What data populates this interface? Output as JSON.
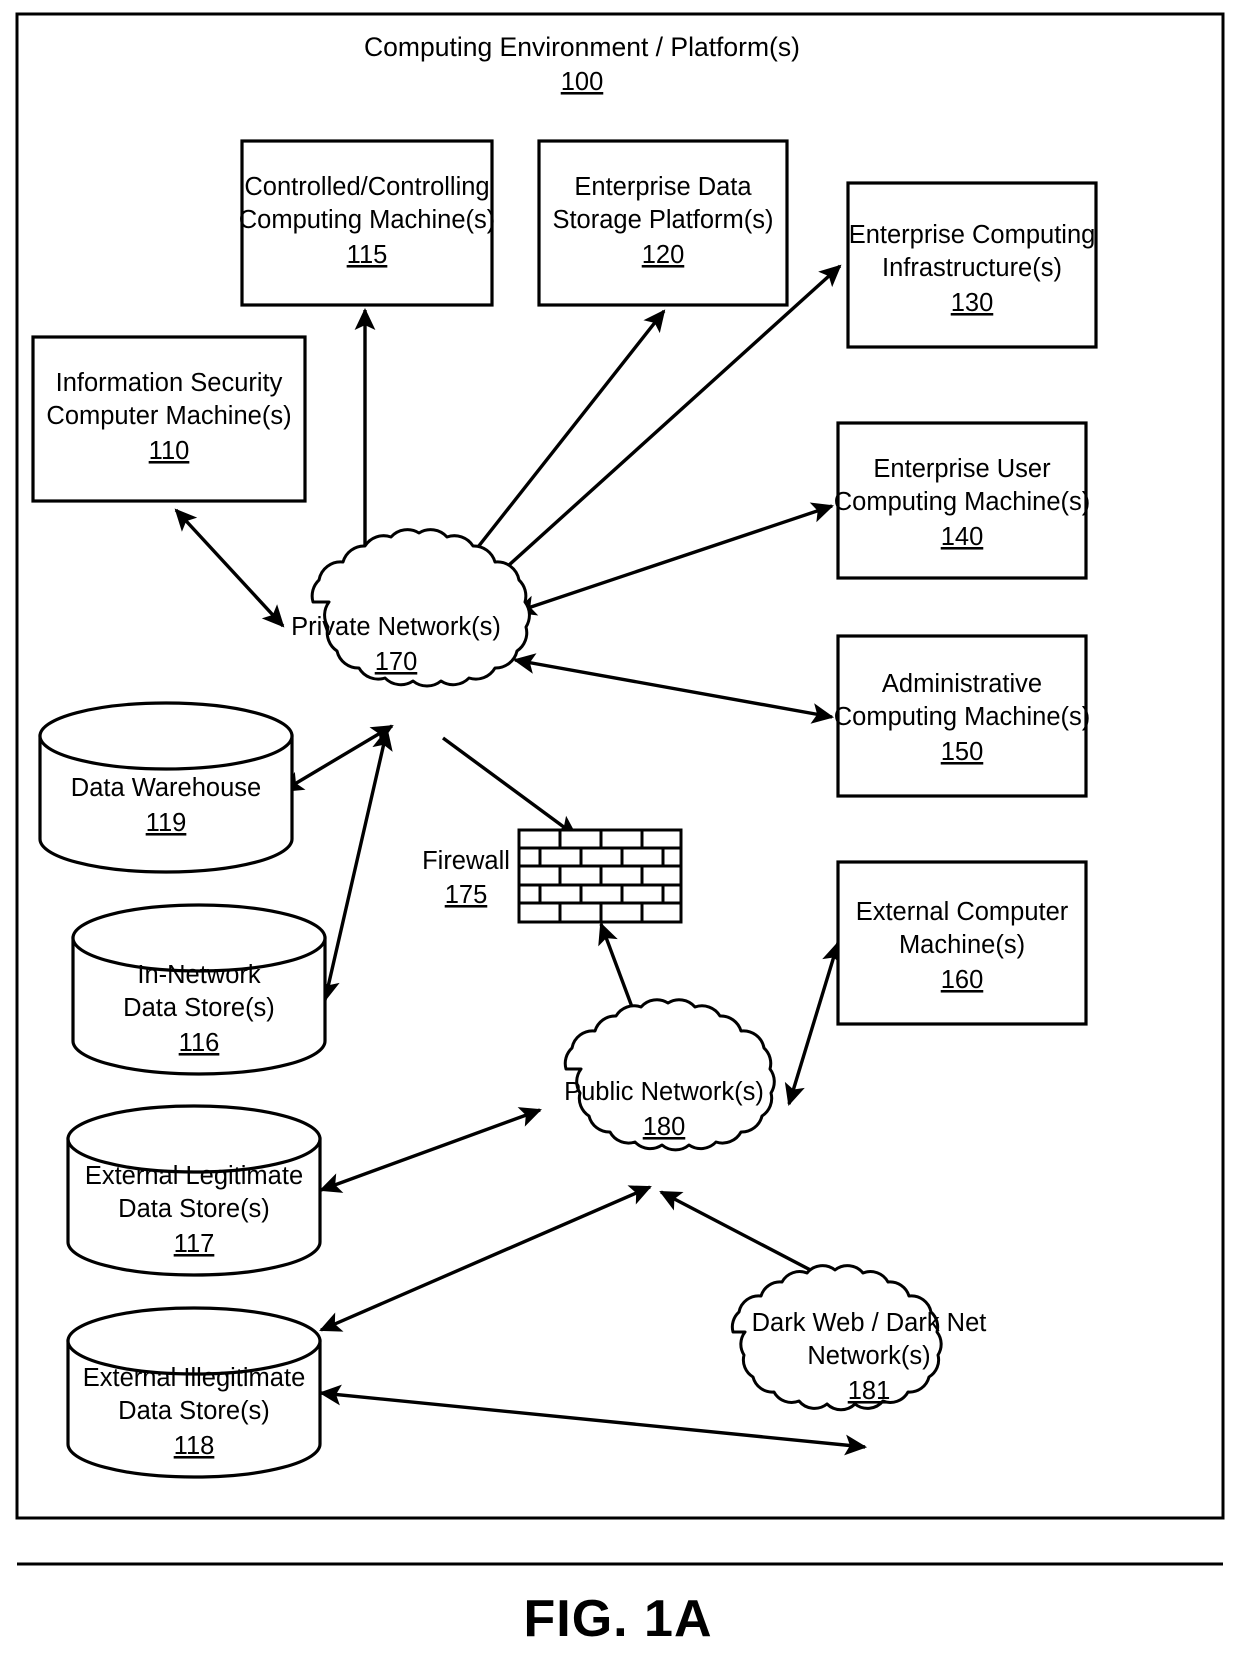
{
  "figure": {
    "caption": "FIG. 1A",
    "title": "Computing Environment / Platform(s)",
    "title_ref": "100"
  },
  "nodes": {
    "infosec": {
      "line1": "Information Security",
      "line2": "Computer Machine(s)",
      "ref": "110",
      "shape": "rect"
    },
    "controlled": {
      "line1": "Controlled/Controlling",
      "line2": "Computing Machine(s)",
      "ref": "115",
      "shape": "rect"
    },
    "storage": {
      "line1": "Enterprise Data",
      "line2": "Storage Platform(s)",
      "ref": "120",
      "shape": "rect"
    },
    "infra": {
      "line1": "Enterprise Computing",
      "line2": "Infrastructure(s)",
      "ref": "130",
      "shape": "rect"
    },
    "enterprise_user": {
      "line1": "Enterprise User",
      "line2": "Computing Machine(s)",
      "ref": "140",
      "shape": "rect"
    },
    "admin": {
      "line1": "Administrative",
      "line2": "Computing Machine(s)",
      "ref": "150",
      "shape": "rect"
    },
    "external_computer": {
      "line1": "External Computer",
      "line2": "Machine(s)",
      "ref": "160",
      "shape": "rect"
    },
    "warehouse": {
      "line1": "Data Warehouse",
      "line2": "",
      "ref": "119",
      "shape": "cylinder"
    },
    "in_network": {
      "line1": "In-Network",
      "line2": "Data Store(s)",
      "ref": "116",
      "shape": "cylinder"
    },
    "ext_legit": {
      "line1": "External Legitimate",
      "line2": "Data Store(s)",
      "ref": "117",
      "shape": "cylinder"
    },
    "ext_illegit": {
      "line1": "External Illegitimate",
      "line2": "Data Store(s)",
      "ref": "118",
      "shape": "cylinder"
    },
    "private_network": {
      "line1": "Private Network(s)",
      "line2": "",
      "ref": "170",
      "shape": "cloud"
    },
    "public_network": {
      "line1": "Public Network(s)",
      "line2": "",
      "ref": "180",
      "shape": "cloud"
    },
    "dark_web": {
      "line1": "Dark Web / Dark Net",
      "line2": "Network(s)",
      "ref": "181",
      "shape": "cloud"
    },
    "firewall": {
      "line1": "Firewall",
      "line2": "",
      "ref": "175",
      "shape": "brick-wall"
    }
  },
  "connections": [
    {
      "from": "private_network",
      "to": "infosec",
      "arrows": "both"
    },
    {
      "from": "private_network",
      "to": "controlled",
      "arrows": "both"
    },
    {
      "from": "private_network",
      "to": "storage",
      "arrows": "both"
    },
    {
      "from": "private_network",
      "to": "infra",
      "arrows": "both"
    },
    {
      "from": "private_network",
      "to": "enterprise_user",
      "arrows": "both"
    },
    {
      "from": "private_network",
      "to": "admin",
      "arrows": "both"
    },
    {
      "from": "private_network",
      "to": "warehouse",
      "arrows": "both"
    },
    {
      "from": "private_network",
      "to": "in_network",
      "arrows": "both"
    },
    {
      "from": "private_network",
      "to": "firewall",
      "arrows": "single"
    },
    {
      "from": "firewall",
      "to": "public_network",
      "arrows": "both"
    },
    {
      "from": "public_network",
      "to": "external_computer",
      "arrows": "both"
    },
    {
      "from": "public_network",
      "to": "ext_legit",
      "arrows": "both"
    },
    {
      "from": "public_network",
      "to": "ext_illegit",
      "arrows": "both"
    },
    {
      "from": "public_network",
      "to": "dark_web",
      "arrows": "both"
    },
    {
      "from": "dark_web",
      "to": "ext_illegit",
      "arrows": "single"
    }
  ],
  "colors": {
    "stroke": "#000000",
    "fill": "#ffffff"
  }
}
